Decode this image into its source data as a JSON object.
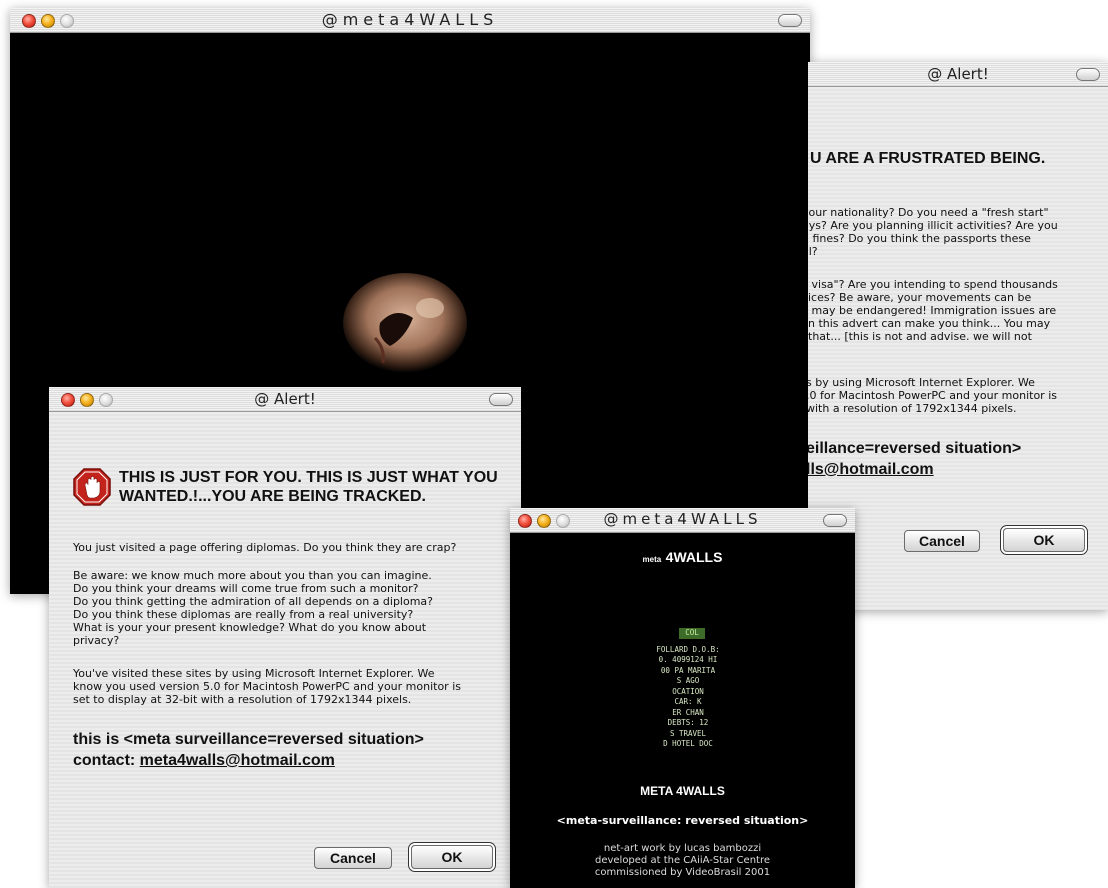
{
  "main_window": {
    "title": "@meta4WALLS"
  },
  "alert_back": {
    "title": "@ Alert!",
    "heading": "U ARE A FRUSTRATED BEING.",
    "p1": "your nationality? Do you need a \"fresh start\"\nays? Are you planning illicit activities? Are you\nd fines? Do you think the passports these\nal?",
    "p2": " visa\"? Are you intending to spend thousands\nices? Be aware, your movements can be\n may be endangered! Immigration issues are\nn this advert can make you think... You may\nthat... [this is not and advise. we will not",
    "p3": "s by using Microsoft Internet Explorer. We\n.0 for Macintosh PowerPC and your monitor is\nwith a resolution of 1792x1344 pixels.",
    "line1": "eillance=reversed situation>",
    "line2": "lls@hotmail.com",
    "cancel": "Cancel",
    "ok": "OK"
  },
  "alert_front": {
    "title": "@ Alert!",
    "heading_1": "THIS IS JUST FOR YOU. THIS IS JUST WHAT YOU",
    "heading_2": "WANTED.!...YOU ARE BEING TRACKED.",
    "p1": "You just visited a page offering diplomas. Do you think they are crap?",
    "p2": "Be aware: we know much more about you than you can imagine.\nDo you think your dreams will come true from such a monitor?\nDo you think getting the admiration of all depends on a diploma?\nDo you think these diplomas are really from a real university?\nWhat is your your present knowledge? What do you know about\nprivacy?",
    "p3": "You've visited these sites by using Microsoft Internet Explorer. We\nknow you used version 5.0 for Macintosh PowerPC and your monitor is\nset to display at 32-bit with a resolution of 1792x1344 pixels.",
    "line1": "this is <meta surveillance=reversed situation>",
    "line2_prefix": "contact: ",
    "line2_email": "meta4walls@hotmail.com",
    "cancel": "Cancel",
    "ok": "OK"
  },
  "small_window": {
    "title": "@meta4WALLS",
    "logo_small": "meta",
    "logo_big": "4WALLS",
    "keyhole_lines": [
      "COL",
      "FOLLARD  D.O.B:",
      "0. 4099124  HI",
      "00 PA  MARITA",
      "S  AGO",
      "OCATION",
      "CAR:  K",
      "ER  CHAN",
      "DEBTS:  12",
      "S  TRAVEL",
      "D  HOTEL  DOC"
    ],
    "brand": "META 4WALLS",
    "tagline": "<meta-surveillance: reversed situation>",
    "credits_1": "net-art work by lucas bambozzi",
    "credits_2": "developed at the CAiiA-Star Centre",
    "credits_3": "commissioned by VideoBrasil 2001"
  }
}
